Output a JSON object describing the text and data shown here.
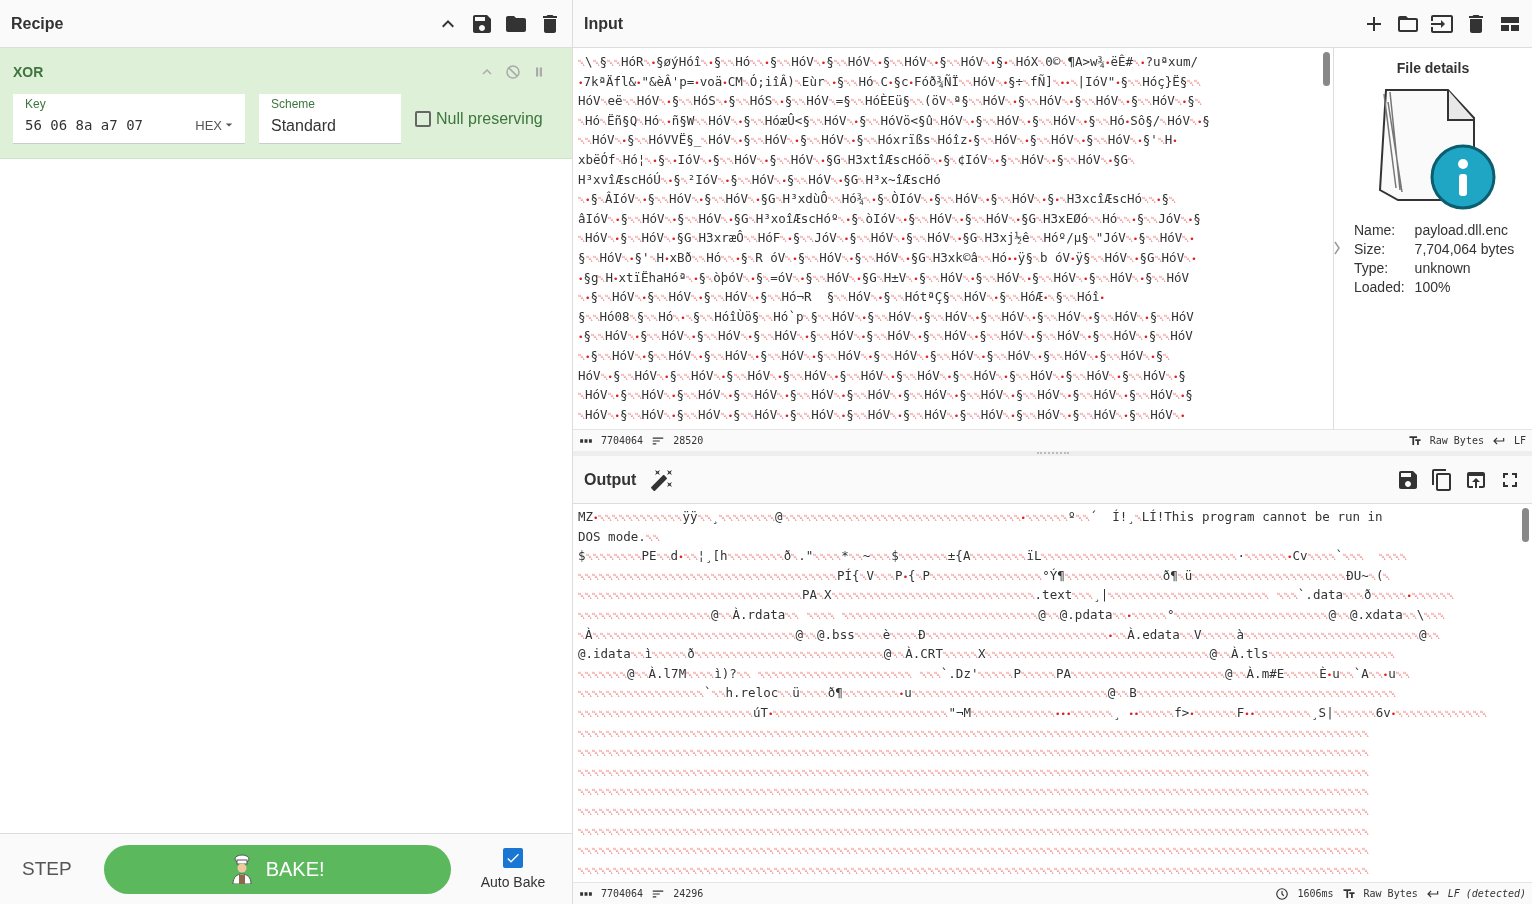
{
  "recipe": {
    "title": "Recipe"
  },
  "operation": {
    "name": "XOR",
    "key": {
      "label": "Key",
      "value": "56 06 8a a7 07",
      "format": "HEX"
    },
    "scheme": {
      "label": "Scheme",
      "value": "Standard"
    },
    "null_preserving": {
      "label": "Null preserving",
      "checked": false
    }
  },
  "controls": {
    "step": "STEP",
    "bake": "BAKE!",
    "auto_bake": {
      "label": "Auto Bake",
      "checked": true
    }
  },
  "input": {
    "title": "Input",
    "lines": [
      "␀\\␀§␀␀HóR␀•§øýHóî␀•§␀␀Hó␀␀•§␀␀HóV␀•§␀␀HóV␀•§␀␀HóV␀•§␀␀HóV␀•§•␀HóX␀0©␀¶A>w¾•ëÊ#␀•?uªxum/",
      "•7kªÄfl&•\"&èÂ'p=•voä•CM␀Ó;iîÂ)␀Eùr␀•§␀␀Hó␀C•§c•Fóð¾ÑÏ␀␀HóV␀•§÷␀fÑ]␀••␀|IóV\"•§␀␀Hóç}Ë§␀␀",
      "HóV␀eë␀␀HóV␀•§␀␀HóS␀•§␀␀HóS␀•§␀␀HóV␀=§␀␀HóÈEü§␀␀(öV␀ª§␀␀HóV␀•§␀␀HóV␀•§␀␀HóV␀•§␀␀HóV␀•§␀",
      "␀Hó␀Ëñ§Q␀Hó␀•ñ§W␀␀HóV␀•§␀␀HóæÛ<§␀␀HóV␀•§␀␀HóVö<§û␀HóV␀•§␀␀HóV␀•§␀␀HóV␀•§␀␀Hó•Sô§/␀HóV␀•§",
      "␀␀HóV␀•§␀␀HóVVË§_␀HóV␀•§␀␀HóV␀•§␀␀HóV␀•§␀␀Hóxrïßs␀Hóîz•§␀␀HóV␀•§␀␀HóV␀•§␀␀HóV␀•§'␀H•",
      "xbëÓf␀Hó¦␀•§␀•IóV␀•§␀␀HóV␀•§␀␀HóV␀•§G␀H3xtîÆscHóö␀•§␀¢IóV␀•§␀␀HóV␀•§␀␀HóV␀•§G␀",
      "H³xvîÆscHóÚ␀•§␀²IóV␀•§␀␀HóV␀•§␀␀HóV␀•§G␀H³x~îÆscHó",
      "␀•§␀ÂIóV␀•§␀␀HóV␀•§␀␀HóV␀•§G␀H³xdùÔ␀␀Hó¾␀•§␀ÒIóV␀•§␀␀HóV␀•§␀␀HóV␀•§•␀H3xcîÆscHó␀␀•§␀",
      "âIóV␀•§␀␀HóV␀•§␀␀HóV␀•§G␀H³xoîÆscHóº␀•§␀òIóV␀•§␀␀HóV␀•§␀␀HóV␀•§G␀H3xEØó␀␀Hó␀␀•§␀␀JóV␀•§",
      "␀HóV␀•§␀␀HóV␀•§G␀H3xræÔ␀␀HóF␀•§␀␀JóV␀•§␀␀HóV␀•§␀␀HóV␀•§G␀H3xj½ê␀␀Hóº/µ§␀\"JóV␀•§␀␀HóV␀•",
      "§␀␀HóV␀•§'␀H•xBð␀␀Hó␀␀•§␀R óV␀•§␀␀HóV␀•§␀␀HóV␀•§G␀H3xk©â␀␀Hó••ÿ§␀b óV•ÿ§␀␀HóV␀•§G␀HóV␀•",
      "•§g␀H•xtïËhaHóª␀•§␀òþóV␀•§␀=óV␀•§␀␀HóV␀•§G␀H±V␀•§␀␀HóV␀•§␀␀HóV␀•§␀␀HóV␀•§␀␀HóV␀•§␀␀HóV",
      "␀•§␀␀HóV␀•§␀␀HóV␀•§␀␀HóV␀•§␀␀Hó¬R  §␀␀HóV␀•§␀␀HótªÇ§␀␀HóV␀•§␀␀HóÆ•␀§␀␀Hóî•",
      "§␀␀Hó08␀§␀␀Hó␀•␀§␀␀HóîÙö§␀␀Hó`p␀§␀␀HóV␀•§␀␀HóV␀•§␀␀HóV␀•§␀␀HóV␀•§␀␀HóV␀•§␀␀HóV␀•§␀␀HóV",
      "•§␀␀HóV␀•§␀␀HóV␀•§␀␀HóV␀•§␀␀HóV␀•§␀␀HóV␀•§␀␀HóV␀•§␀␀HóV␀•§␀␀HóV␀•§␀␀HóV␀•§␀␀HóV␀•§␀␀HóV",
      "␀•§␀␀HóV␀•§␀␀HóV␀•§␀␀HóV␀•§␀␀HóV␀•§␀␀HóV␀•§␀␀HóV␀•§␀␀HóV␀•§␀␀HóV␀•§␀␀HóV␀•§␀␀HóV␀•§␀",
      "HóV␀•§␀␀HóV␀•§␀␀HóV␀•§␀␀HóV␀•§␀␀HóV␀•§␀␀HóV␀•§␀␀HóV␀•§␀␀HóV␀•§␀␀HóV␀•§␀␀HóV␀•§␀␀HóV␀•§",
      "␀HóV␀•§␀␀HóV␀•§␀␀HóV␀•§␀␀HóV␀•§␀␀HóV␀•§␀␀HóV␀•§␀␀HóV␀•§␀␀HóV␀•§␀␀HóV␀•§␀␀HóV␀•§␀␀HóV␀•§",
      "␀HóV␀•§␀␀HóV␀•§␀␀HóV␀•§␀␀HóV␀•§␀␀HóV␀•§␀␀HóV␀•§␀␀HóV␀•§␀␀HóV␀•§␀␀HóV␀•§␀␀HóV␀•§␀␀HóV␀•"
    ],
    "file_details": {
      "title": "File details",
      "rows": [
        {
          "label": "Name:",
          "value": "payload.dll.enc"
        },
        {
          "label": "Size:",
          "value": "7,704,064 bytes"
        },
        {
          "label": "Type:",
          "value": "unknown"
        },
        {
          "label": "Loaded:",
          "value": "100%"
        }
      ]
    },
    "status": {
      "length": "7704064",
      "lines": "28520",
      "encoding": "Raw Bytes",
      "eol": "LF"
    }
  },
  "output": {
    "title": "Output",
    "lines": [
      "MZ•␀␀␀␀␀␀␀␀␀␀␀␀ÿÿ␀␀¸␀␀␀␀␀␀␀␀@␀␀␀␀␀␀␀␀␀␀␀␀␀␀␀␀␀␀␀␀␀␀␀␀␀␀␀␀␀␀␀␀␀␀•␀␀␀␀␀␀º␀␀´  Í!¸␀LÍ!This program cannot be run in",
      "DOS mode.␀␀",
      "$␀␀␀␀␀␀␀␀PE␀␀d•␀␀¦¸[h␀␀␀␀␀␀␀␀ð␀.\"␀␀␀␀*␀␀~␀␀␀$␀␀␀␀␀␀␀±{A␀␀␀␀␀␀␀␀ïL␀␀␀␀␀␀␀␀␀␀␀␀␀␀␀␀␀␀␀␀␀␀␀␀␀␀␀␀·␀␀␀␀␀␀•Cv␀␀␀␀`␀␀␀  ␀␀␀␀",
      "␀␀␀␀␀␀␀␀␀␀␀␀␀␀␀␀␀␀␀␀␀␀␀␀␀␀␀␀␀␀␀␀␀␀␀␀␀PÍ{␀V␀␀␀P•{␀P␀␀␀␀␀␀␀␀␀␀␀␀␀␀␀␀°Ý¶␀␀␀␀␀␀␀␀␀␀␀␀␀␀ð¶␀ü␀␀␀␀␀␀␀␀␀␀␀␀␀␀␀␀␀␀␀␀␀␀ÐU~␀(␀",
      "␀␀␀␀␀␀␀␀␀␀␀␀␀␀␀␀␀␀␀␀␀␀␀␀␀␀␀␀␀␀␀␀PA␀X␀␀␀␀␀␀␀␀␀␀␀␀␀␀␀␀␀␀␀␀␀␀␀␀␀␀␀␀␀.text␀␀␀¸|␀␀␀␀␀␀␀␀␀␀␀␀␀␀␀␀␀␀␀␀␀␀␀ ␀␀␀`.data␀␀␀ð␀␀␀␀␀•␀␀␀␀␀␀",
      "␀␀␀␀␀␀␀␀␀␀␀␀␀␀␀␀␀␀␀@␀␀À.rdata␀␀ ␀␀␀␀ ␀␀␀␀␀␀␀␀␀␀␀␀␀␀␀␀␀␀␀␀␀␀␀␀␀␀␀␀@␀␀@.pdata␀␀•␀␀␀␀␀°␀␀␀␀␀␀␀␀␀␀␀␀␀␀␀␀␀␀␀␀␀␀@␀␀@.xdata␀␀\\␀␀␀",
      "␀À␀␀␀␀␀␀␀␀␀␀␀␀␀␀␀␀␀␀␀␀␀␀␀␀␀␀␀␀␀@␀␀@.bss␀␀␀␀è␀␀␀␀Ð␀␀␀␀␀␀␀␀␀␀␀␀␀␀␀␀␀␀␀␀␀␀␀␀␀␀•␀␀À.edata␀␀V␀␀␀␀␀à␀␀␀␀␀␀␀␀␀␀␀␀␀␀␀␀␀␀␀␀␀␀␀␀␀@␀␀",
      "@.idata␀␀ì␀␀␀␀␀ð␀␀␀␀␀␀␀␀␀␀␀␀␀␀␀␀␀␀␀␀␀␀␀␀␀␀␀@␀␀À.CRT␀␀␀␀␀X␀␀␀␀␀␀␀␀␀␀␀␀␀␀␀␀␀␀␀␀␀␀␀␀␀␀␀␀␀␀␀␀@␀␀À.tls␀␀␀␀␀␀␀␀␀␀␀␀␀␀␀␀␀␀",
      "␀␀␀␀␀␀␀@␀␀À.l7M␀␀␀␀ì)?␀␀ ␀␀␀␀␀␀␀␀␀␀␀␀␀␀␀␀␀␀␀␀␀␀ ␀␀␀`.Dz'␀␀␀␀␀P␀␀␀␀␀PA␀␀␀␀␀␀␀␀␀␀␀␀␀␀␀␀␀␀␀␀␀␀@␀␀À.m#E␀␀␀␀␀È•u␀␀`A␀␀•u␀␀",
      "␀␀␀␀␀␀␀␀␀␀␀␀␀␀␀␀␀␀`␀␀h.reloc␀␀ü␀␀␀␀ð¶␀␀␀␀␀␀␀␀•u␀␀␀␀␀␀␀␀␀␀␀␀␀␀␀␀␀␀␀␀␀␀␀␀␀␀␀␀@␀␀B␀␀␀␀␀␀␀␀␀␀␀␀␀␀␀␀␀␀␀␀␀␀␀␀␀␀␀␀␀␀␀␀␀␀␀␀␀",
      "␀␀␀␀␀␀␀␀␀␀␀␀␀␀␀␀␀␀␀␀␀␀␀␀␀úT•␀␀␀␀␀␀␀␀␀␀␀␀␀␀␀␀␀␀␀␀␀␀␀␀␀\"¬M␀␀␀␀␀␀␀␀␀␀␀␀•••␀␀␀␀␀␀¸ ••␀␀␀␀␀f>•␀␀␀␀␀␀F••␀␀␀␀␀␀␀␀¸S|␀␀␀␀␀␀6v•␀␀␀␀␀␀␀␀␀␀␀␀␀",
      "␀␀␀␀␀␀␀␀␀␀␀␀␀␀␀␀␀␀␀␀␀␀␀␀␀␀␀␀␀␀␀␀␀␀␀␀␀␀␀␀␀␀␀␀␀␀␀␀␀␀␀␀␀␀␀␀␀␀␀␀␀␀␀␀␀␀␀␀␀␀␀␀␀␀␀␀␀␀␀␀␀␀␀␀␀␀␀␀␀␀␀␀␀␀␀␀␀␀␀␀␀␀␀␀␀␀␀␀␀␀␀␀␀",
      "␀␀␀␀␀␀␀␀␀␀␀␀␀␀␀␀␀␀␀␀␀␀␀␀␀␀␀␀␀␀␀␀␀␀␀␀␀␀␀␀␀␀␀␀␀␀␀␀␀␀␀␀␀␀␀␀␀␀␀␀␀␀␀␀␀␀␀␀␀␀␀␀␀␀␀␀␀␀␀␀␀␀␀␀␀␀␀␀␀␀␀␀␀␀␀␀␀␀␀␀␀␀␀␀␀␀␀␀␀␀␀␀␀",
      "␀␀␀␀␀␀␀␀␀␀␀␀␀␀␀␀␀␀␀␀␀␀␀␀␀␀␀␀␀␀␀␀␀␀␀␀␀␀␀␀␀␀␀␀␀␀␀␀␀␀␀␀␀␀␀␀␀␀␀␀␀␀␀␀␀␀␀␀␀␀␀␀␀␀␀␀␀␀␀␀␀␀␀␀␀␀␀␀␀␀␀␀␀␀␀␀␀␀␀␀␀␀␀␀␀␀␀␀␀␀␀␀␀",
      "␀␀␀␀␀␀␀␀␀␀␀␀␀␀␀␀␀␀␀␀␀␀␀␀␀␀␀␀␀␀␀␀␀␀␀␀␀␀␀␀␀␀␀␀␀␀␀␀␀␀␀␀␀␀␀␀␀␀␀␀␀␀␀␀␀␀␀␀␀␀␀␀␀␀␀␀␀␀␀␀␀␀␀␀␀␀␀␀␀␀␀␀␀␀␀␀␀␀␀␀␀␀␀␀␀␀␀␀␀␀␀␀␀",
      "␀␀␀␀␀␀␀␀␀␀␀␀␀␀␀␀␀␀␀␀␀␀␀␀␀␀␀␀␀␀␀␀␀␀␀␀␀␀␀␀␀␀␀␀␀␀␀␀␀␀␀␀␀␀␀␀␀␀␀␀␀␀␀␀␀␀␀␀␀␀␀␀␀␀␀␀␀␀␀␀␀␀␀␀␀␀␀␀␀␀␀␀␀␀␀␀␀␀␀␀␀␀␀␀␀␀␀␀␀␀␀␀␀",
      "␀␀␀␀␀␀␀␀␀␀␀␀␀␀␀␀␀␀␀␀␀␀␀␀␀␀␀␀␀␀␀␀␀␀␀␀␀␀␀␀␀␀␀␀␀␀␀␀␀␀␀␀␀␀␀␀␀␀␀␀␀␀␀␀␀␀␀␀␀␀␀␀␀␀␀␀␀␀␀␀␀␀␀␀␀␀␀␀␀␀␀␀␀␀␀␀␀␀␀␀␀␀␀␀␀␀␀␀␀␀␀␀␀",
      "␀␀␀␀␀␀␀␀␀␀␀␀␀␀␀␀␀␀␀␀␀␀␀␀␀␀␀␀␀␀␀␀␀␀␀␀␀␀␀␀␀␀␀␀␀␀␀␀␀␀␀␀␀␀␀␀␀␀␀␀␀␀␀␀␀␀␀␀␀␀␀␀␀␀␀␀␀␀␀␀␀␀␀␀␀␀␀␀␀␀␀␀␀␀␀␀␀␀␀␀␀␀␀␀␀␀␀␀␀␀␀␀␀",
      "␀␀␀␀␀␀␀␀␀␀␀␀␀␀␀␀␀␀␀␀␀␀␀␀␀␀␀␀␀␀␀␀␀␀␀␀␀␀␀␀␀␀␀␀␀␀␀␀␀␀␀␀␀␀␀␀␀␀␀␀␀␀␀␀␀␀␀␀␀␀␀␀␀␀␀␀␀␀␀␀␀␀␀␀␀␀␀␀␀␀␀␀␀␀␀␀␀␀␀␀␀␀␀␀␀␀␀␀␀␀␀␀␀"
    ],
    "status": {
      "length": "7704064",
      "lines": "24296",
      "time": "1606ms",
      "encoding": "Raw Bytes",
      "eol": "LF (detected)"
    }
  }
}
